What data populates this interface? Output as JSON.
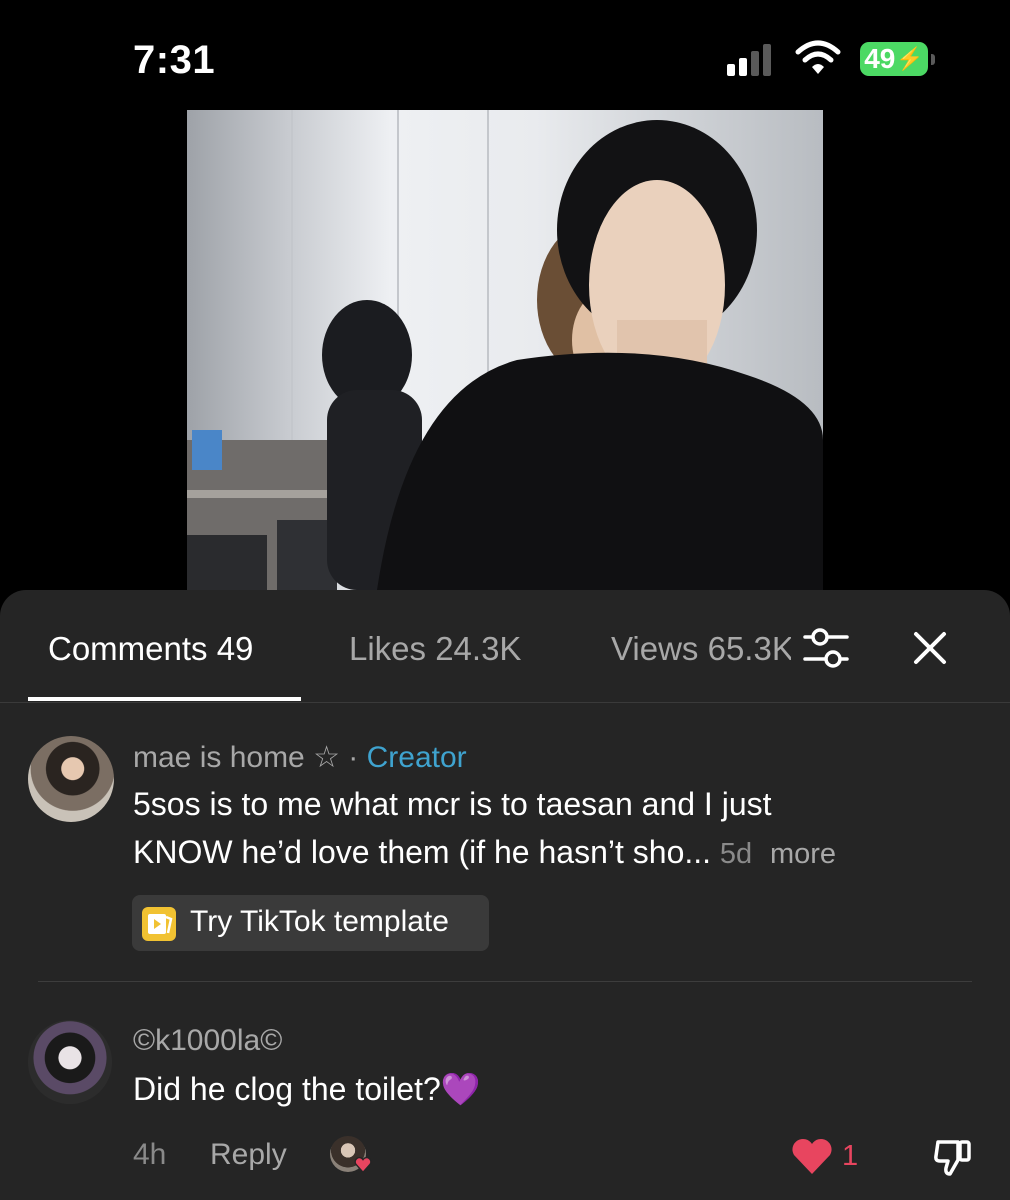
{
  "status_bar": {
    "time": "7:31",
    "battery": "49"
  },
  "tabs": [
    {
      "label": "Comments 49"
    },
    {
      "label": "Likes 24.3K"
    },
    {
      "label": "Views 65.3K"
    }
  ],
  "comments": [
    {
      "username": "mae is home ☆",
      "separator": " · ",
      "badge": "Creator",
      "line1": "5sos is to me what mcr is to taesan and I just",
      "line2": "KNOW he’d love them (if he hasn’t sho...",
      "time": "5d",
      "more": "more",
      "template_button": "Try TikTok template"
    },
    {
      "username": "©k1000la©",
      "text": "Did he clog the toilet?💜",
      "time": "4h",
      "reply": "Reply",
      "likes": "1"
    }
  ],
  "colors": {
    "accent_creator": "#3fa3cf",
    "like_red": "#e8455f",
    "battery_green": "#4cd964"
  },
  "icons": [
    "signal-icon",
    "wifi-icon",
    "battery-icon",
    "filter-icon",
    "close-icon",
    "template-icon",
    "heart-icon",
    "dislike-icon"
  ]
}
